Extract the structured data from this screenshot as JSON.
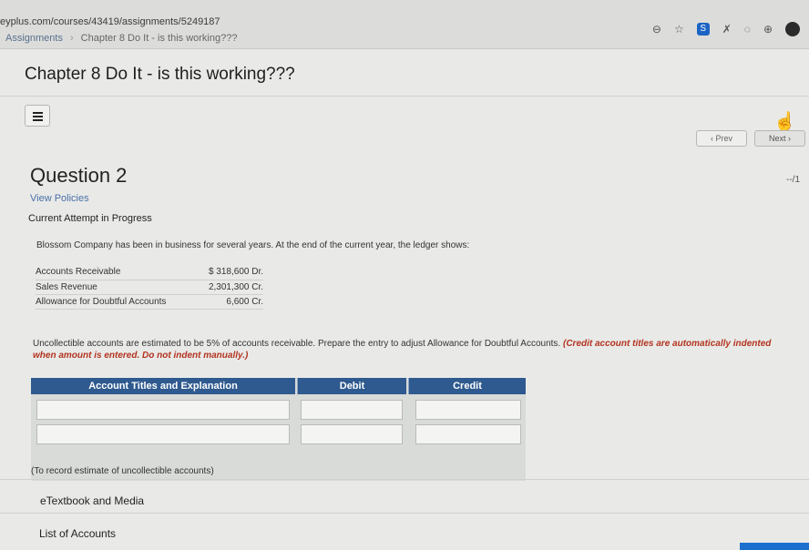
{
  "browser": {
    "url": "eyplus.com/courses/43419/assignments/5249187",
    "breadcrumb": [
      "Assignments",
      "Chapter 8 Do It - is this working???"
    ]
  },
  "assignment": {
    "title": "Chapter 8 Do It - is this working???"
  },
  "nav": {
    "prev_label": "‹ Prev",
    "next_label": "Next ›"
  },
  "question": {
    "title": "Question 2",
    "points": "--/1",
    "view_policies": "View Policies",
    "attempt_status": "Current Attempt in Progress",
    "intro": "Blossom Company has been in business for several years. At the end of the current year, the ledger shows:",
    "ledger": [
      {
        "account": "Accounts Receivable",
        "amount": "$ 318,600 Dr."
      },
      {
        "account": "Sales Revenue",
        "amount": "2,301,300 Cr."
      },
      {
        "account": "Allowance for Doubtful Accounts",
        "amount": "6,600 Cr."
      }
    ],
    "instruction": "Uncollectible accounts are estimated to be 5% of accounts receivable. Prepare the entry to adjust Allowance for Doubtful Accounts.",
    "instruction_note": "(Credit account titles are automatically indented when amount is entered. Do not indent manually.)"
  },
  "journal": {
    "headers": [
      "Account Titles and Explanation",
      "Debit",
      "Credit"
    ],
    "rows": [
      {
        "account": "",
        "debit": "",
        "credit": ""
      },
      {
        "account": "",
        "debit": "",
        "credit": ""
      }
    ],
    "explanation": "(To record estimate of uncollectible accounts)"
  },
  "resources": {
    "etextbook": "eTextbook and Media",
    "accounts": "List of Accounts"
  },
  "colors": {
    "header_blue": "#2f5a8f",
    "link_blue": "#4b6fa8",
    "note_red": "#b3321e"
  },
  "icons": [
    "zoom-icon",
    "star-icon",
    "extension-s-icon",
    "extension-icon",
    "extension-icon",
    "extension-icon",
    "profile-icon"
  ]
}
